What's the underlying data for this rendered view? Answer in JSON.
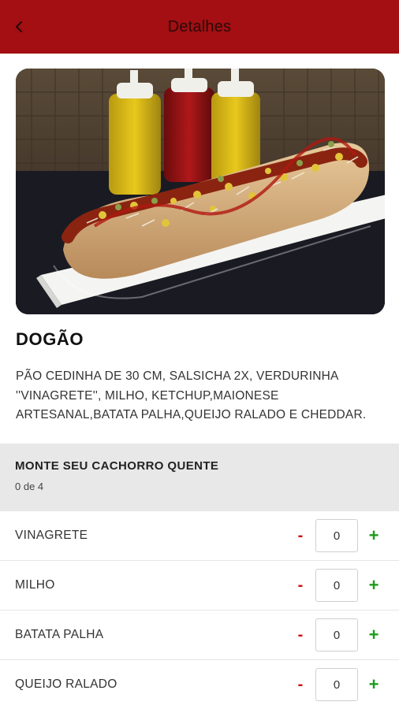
{
  "header": {
    "title": "Detalhes",
    "back_icon": "chevron-left-icon",
    "background_color": "#a30f12"
  },
  "product": {
    "image_description_icon": "product-photo",
    "name": "DOGÃO",
    "description": "PÃO CEDINHA DE 30 CM, SALSICHA 2X, VERDURINHA ''VINAGRETE'', MILHO, KETCHUP,MAIONESE ARTESANAL,BATATA PALHA,QUEIJO RALADO E CHEDDAR."
  },
  "customization": {
    "title": "MONTE SEU CACHORRO QUENTE",
    "count": "0 de 4",
    "options": [
      {
        "label": "VINAGRETE",
        "quantity": "0",
        "minus": "-",
        "plus": "+"
      },
      {
        "label": "MILHO",
        "quantity": "0",
        "minus": "-",
        "plus": "+"
      },
      {
        "label": "BATATA PALHA",
        "quantity": "0",
        "minus": "-",
        "plus": "+"
      },
      {
        "label": "QUEIJO RALADO",
        "quantity": "0",
        "minus": "-",
        "plus": "+"
      }
    ],
    "minus_color": "#cc1010",
    "plus_color": "#1a9e1a"
  }
}
